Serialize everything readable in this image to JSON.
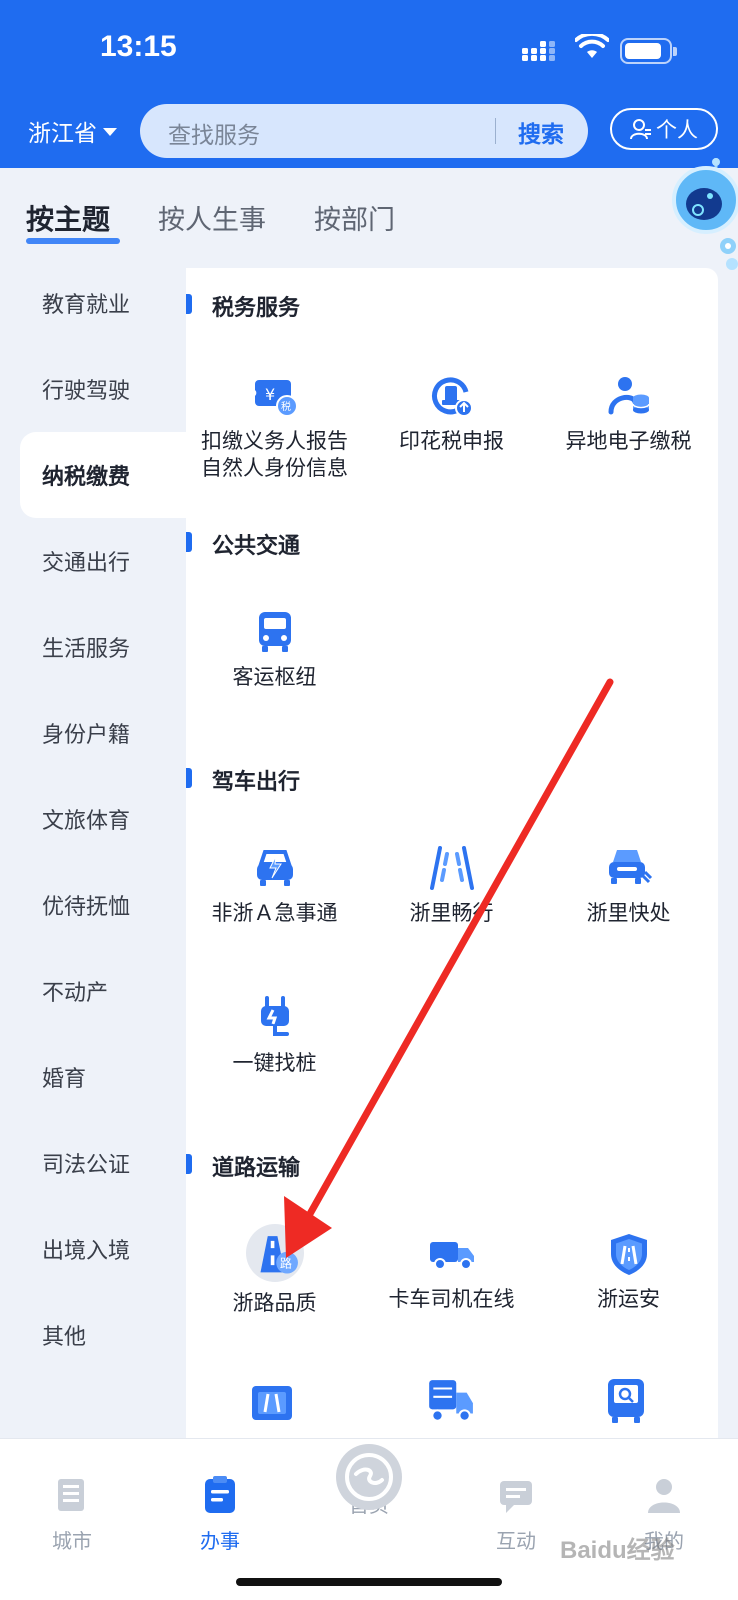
{
  "status_bar": {
    "time": "13:15"
  },
  "header": {
    "province": "浙江省",
    "search_placeholder": "查找服务",
    "search_button": "搜索",
    "personal_button": "个人"
  },
  "tabs": [
    {
      "label": "按主题",
      "active": true
    },
    {
      "label": "按人生事",
      "active": false
    },
    {
      "label": "按部门",
      "active": false
    }
  ],
  "sidebar": {
    "items": [
      {
        "label": "教育就业",
        "active": false
      },
      {
        "label": "行驶驾驶",
        "active": false
      },
      {
        "label": "纳税缴费",
        "active": true
      },
      {
        "label": "交通出行",
        "active": false
      },
      {
        "label": "生活服务",
        "active": false
      },
      {
        "label": "身份户籍",
        "active": false
      },
      {
        "label": "文旅体育",
        "active": false
      },
      {
        "label": "优待抚恤",
        "active": false
      },
      {
        "label": "不动产",
        "active": false
      },
      {
        "label": "婚育",
        "active": false
      },
      {
        "label": "司法公证",
        "active": false
      },
      {
        "label": "出境入境",
        "active": false
      },
      {
        "label": "其他",
        "active": false
      }
    ]
  },
  "sections": [
    {
      "title": "税务服务",
      "services": [
        {
          "label_line1": "扣缴义务人报告",
          "label_line2": "自然人身份信息",
          "icon": "tax-ticket-icon"
        },
        {
          "label_line1": "印花税申报",
          "label_line2": "",
          "icon": "stamp-tax-icon"
        },
        {
          "label_line1": "异地电子缴税",
          "label_line2": "",
          "icon": "person-coins-icon"
        }
      ]
    },
    {
      "title": "公共交通",
      "services": [
        {
          "label_line1": "客运枢纽",
          "label_line2": "",
          "icon": "bus-icon"
        }
      ]
    },
    {
      "title": "驾车出行",
      "services": [
        {
          "label_line1": "非浙Ａ急事通",
          "label_line2": "",
          "icon": "car-lightning-icon"
        },
        {
          "label_line1": "浙里畅行",
          "label_line2": "",
          "icon": "road-lanes-icon"
        },
        {
          "label_line1": "浙里快处",
          "label_line2": "",
          "icon": "car-accident-icon"
        },
        {
          "label_line1": "一键找桩",
          "label_line2": "",
          "icon": "charging-plug-icon"
        }
      ]
    },
    {
      "title": "道路运输",
      "services": [
        {
          "label_line1": "浙路品质",
          "label_line2": "",
          "icon": "road-quality-icon"
        },
        {
          "label_line1": "卡车司机在线",
          "label_line2": "",
          "icon": "truck-icon"
        },
        {
          "label_line1": "浙运安",
          "label_line2": "",
          "icon": "shield-road-icon"
        }
      ]
    }
  ],
  "bottom_nav": {
    "items": [
      {
        "label": "城市",
        "icon": "city-icon",
        "active": false
      },
      {
        "label": "办事",
        "icon": "clipboard-icon",
        "active": true
      },
      {
        "label": "首页",
        "icon": "home-logo-icon",
        "active": false
      },
      {
        "label": "互动",
        "icon": "chat-icon",
        "active": false
      },
      {
        "label": "我的",
        "icon": "user-icon",
        "active": false
      }
    ]
  },
  "watermark": "Baidu经验",
  "colors": {
    "primary": "#1f6cf0",
    "annotation_arrow": "#ee2a24"
  }
}
